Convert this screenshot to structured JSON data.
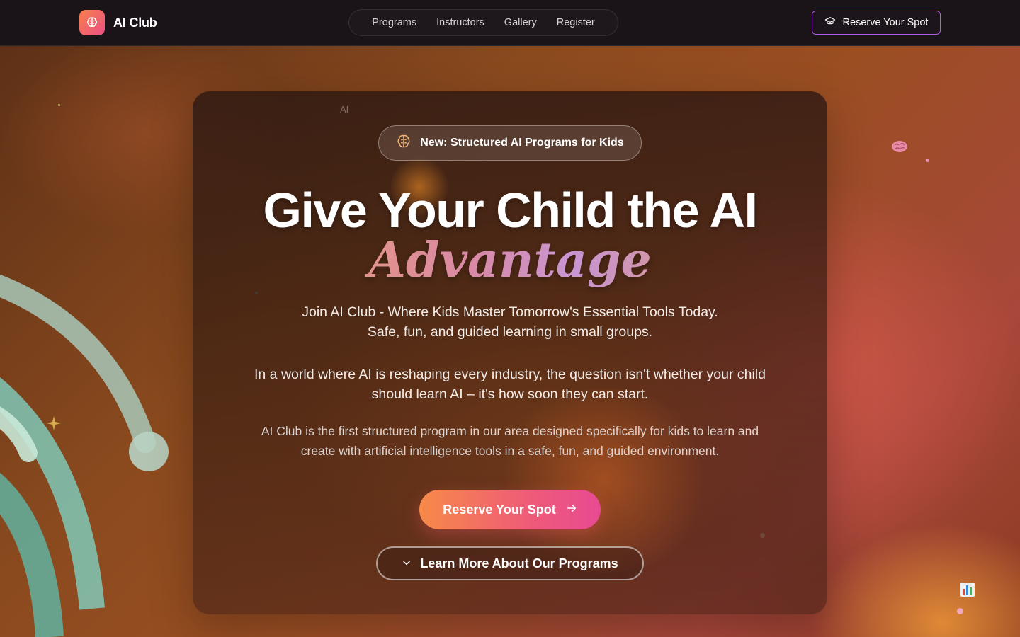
{
  "header": {
    "brand": {
      "name": "AI Club",
      "logo_icon": "brain-icon"
    },
    "nav": [
      {
        "label": "Programs"
      },
      {
        "label": "Instructors"
      },
      {
        "label": "Gallery"
      },
      {
        "label": "Register"
      }
    ],
    "cta": {
      "label": "Reserve Your Spot",
      "icon": "graduation-cap-icon"
    }
  },
  "hero": {
    "corner_tag": "AI",
    "badge": {
      "label": "New: Structured AI Programs for Kids",
      "icon": "brain-icon"
    },
    "headline": "Give Your Child the AI",
    "headline_accent": "Advantage",
    "subhead_line1": "Join AI Club - Where Kids Master Tomorrow's Essential Tools Today.",
    "subhead_line2": "Safe, fun, and guided learning in small groups.",
    "intro_line1": "In a world where AI is reshaping every industry, the question isn't whether your child",
    "intro_line2": "should learn AI – it's how soon they can start.",
    "desc_line1": "AI Club is the first structured program in our area designed specifically for kids to learn and",
    "desc_line2": "create with artificial intelligence tools in a safe, fun, and guided environment.",
    "primary_cta": {
      "label": "Reserve Your Spot",
      "icon": "arrow-right-icon"
    },
    "secondary_cta": {
      "label": "Learn More About Our Programs",
      "icon": "chevron-down-icon"
    }
  },
  "decorations": {
    "floating_icons": [
      "brain-emoji-icon",
      "bar-chart-emoji-icon",
      "sparkle-icon"
    ]
  },
  "colors": {
    "accent_orange": "#f78a48",
    "accent_pink": "#e84a92",
    "accent_purple": "#b65be3",
    "header_bg": "#1a1418"
  }
}
